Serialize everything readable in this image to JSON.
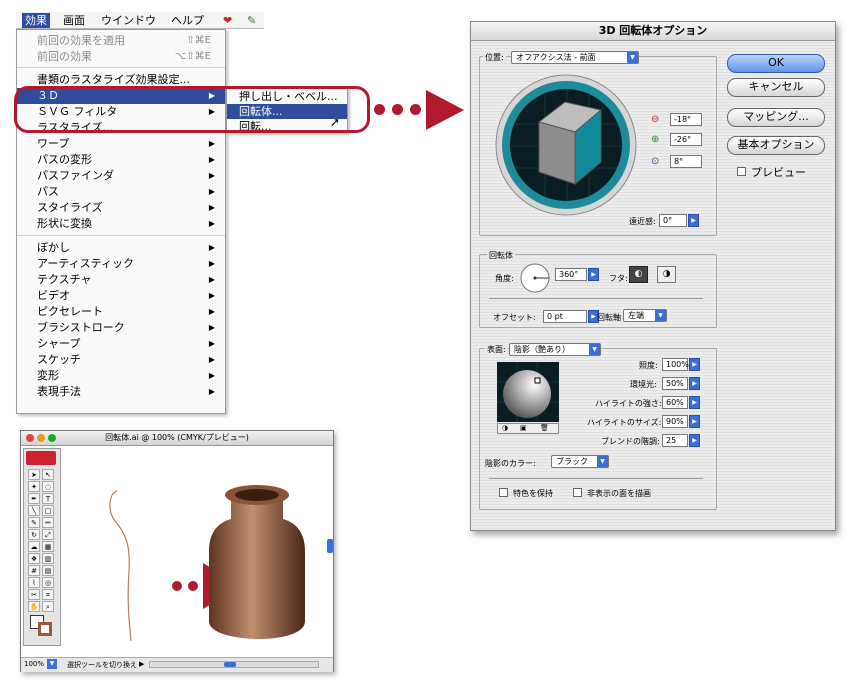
{
  "menubar": {
    "items": [
      "効果",
      "画面",
      "ウインドウ",
      "ヘルプ"
    ]
  },
  "effect_menu": {
    "items": [
      {
        "label": "前回の効果を適用",
        "shortcut": "⇧⌘E",
        "disabled": true
      },
      {
        "label": "前回の効果",
        "shortcut": "⌥⇧⌘E",
        "disabled": true
      },
      {
        "label": "書類のラスタライズ効果設定...",
        "shortcut": "",
        "disabled": false
      },
      {
        "label": "３Ｄ",
        "submenu": true,
        "selected": true
      },
      {
        "label": "ＳＶＧ フィルタ",
        "submenu": true
      },
      {
        "label": "ラスタライズ...",
        "submenu": false
      },
      {
        "label": "ワープ",
        "submenu": true
      },
      {
        "label": "パスの変形",
        "submenu": true
      },
      {
        "label": "パスファインダ",
        "submenu": true
      },
      {
        "label": "パス",
        "submenu": true
      },
      {
        "label": "スタイライズ",
        "submenu": true
      },
      {
        "label": "形状に変換",
        "submenu": true
      },
      {
        "label": "ぼかし",
        "submenu": true
      },
      {
        "label": "アーティスティック",
        "submenu": true
      },
      {
        "label": "テクスチャ",
        "submenu": true
      },
      {
        "label": "ビデオ",
        "submenu": true
      },
      {
        "label": "ピクセレート",
        "submenu": true
      },
      {
        "label": "ブラシストローク",
        "submenu": true
      },
      {
        "label": "シャープ",
        "submenu": true
      },
      {
        "label": "スケッチ",
        "submenu": true
      },
      {
        "label": "変形",
        "submenu": true
      },
      {
        "label": "表現手法",
        "submenu": true
      }
    ]
  },
  "submenu_3d": {
    "items": [
      "押し出し・ベベル...",
      "回転体...",
      "回転..."
    ]
  },
  "dialog": {
    "title": "3D 回転体オプション",
    "position_label": "位置:",
    "position_value": "オフアクシス法 - 前面",
    "rotation_x": "-18°",
    "rotation_y": "-26°",
    "rotation_z": "8°",
    "perspective_label": "遠近感:",
    "perspective_value": "0°",
    "revolve_group_label": "回転体",
    "angle_label": "角度:",
    "angle_value": "360°",
    "cap_label": "フタ:",
    "offset_label": "オフセット:",
    "offset_value": "0 pt",
    "axis_label": "回転軸",
    "axis_value": "左端",
    "surface_label": "表面:",
    "surface_value": "陰影（艶あり）",
    "light_intensity_label": "照度:",
    "light_intensity_value": "100%",
    "ambient_label": "環境光:",
    "ambient_value": "50%",
    "highlight_intensity_label": "ハイライトの強さ:",
    "highlight_intensity_value": "60%",
    "highlight_size_label": "ハイライトのサイズ:",
    "highlight_size_value": "90%",
    "blend_steps_label": "ブレンドの階調:",
    "blend_steps_value": "25",
    "shading_color_label": "陰影のカラー:",
    "shading_color_value": "ブラック",
    "preserve_spot_label": "特色を保持",
    "draw_hidden_label": "非表示の面を描画",
    "buttons": {
      "ok": "OK",
      "cancel": "キャンセル",
      "map": "マッピング...",
      "basic": "基本オプション",
      "preview": "プレビュー"
    },
    "colors": {
      "cube_front": "#138a99",
      "cube_top": "#b8b8b8",
      "ring": "#1e8b9b"
    }
  },
  "document": {
    "title": "回転体.ai @ 100% (CMYK/プレビュー)",
    "zoom": "100%",
    "status": "選択ツールを切り換え"
  }
}
